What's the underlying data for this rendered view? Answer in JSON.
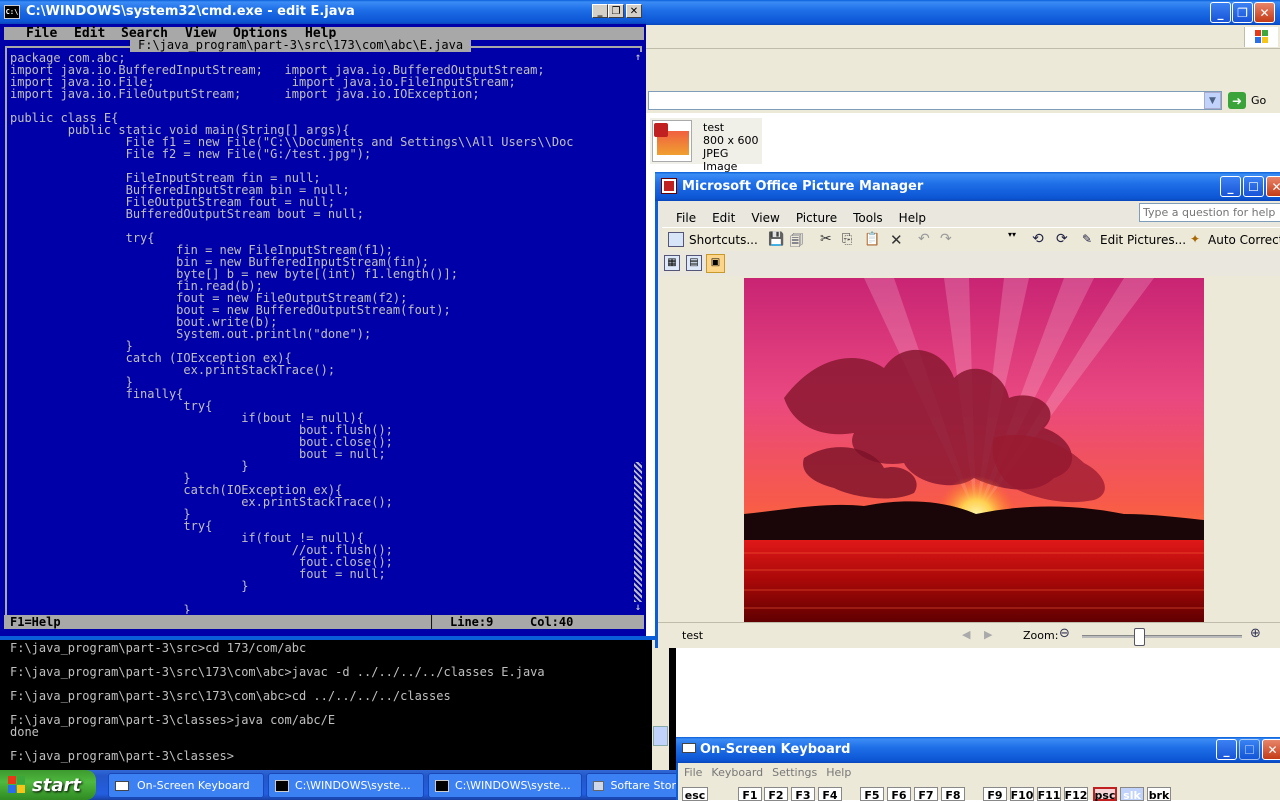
{
  "background_window": {
    "go_label": "Go",
    "file_name": "test",
    "file_dims": "800 x 600",
    "file_type": "JPEG Image"
  },
  "cmd": {
    "title": "C:\\WINDOWS\\system32\\cmd.exe - edit E.java",
    "menu": [
      "File",
      "Edit",
      "Search",
      "View",
      "Options",
      "Help"
    ],
    "file_path": "F:\\java_program\\part-3\\src\\173\\com\\abc\\E.java",
    "code": "package com.abc;\nimport java.io.BufferedInputStream;   import java.io.BufferedOutputStream;\nimport java.io.File;                   import java.io.FileInputStream;\nimport java.io.FileOutputStream;      import java.io.IOException;\n\npublic class E{\n        public static void main(String[] args){\n                File f1 = new File(\"C:\\\\Documents and Settings\\\\All Users\\\\Doc\n                File f2 = new File(\"G:/test.jpg\");\n\n                FileInputStream fin = null;\n                BufferedInputStream bin = null;\n                FileOutputStream fout = null;\n                BufferedOutputStream bout = null;\n\n                try{\n                       fin = new FileInputStream(f1);\n                       bin = new BufferedInputStream(fin);\n                       byte[] b = new byte[(int) f1.length()];\n                       fin.read(b);\n                       fout = new FileOutputStream(f2);\n                       bout = new BufferedOutputStream(fout);\n                       bout.write(b);\n                       System.out.println(\"done\");\n                }\n                catch (IOException ex){\n                        ex.printStackTrace();\n                }\n                finally{\n                        try{\n                                if(bout != null){\n                                        bout.flush();\n                                        bout.close();\n                                        bout = null;\n                                }\n                        }\n                        catch(IOException ex){\n                                ex.printStackTrace();\n                        }\n                        try{\n                                if(fout != null){\n                                       //out.flush();\n                                        fout.close();\n                                        fout = null;\n                                }\n\n                        }",
    "status_help": "F1=Help",
    "status_line": "Line:9",
    "status_col": "Col:40",
    "console": "F:\\java_program\\part-3\\src>cd 173/com/abc\n\nF:\\java_program\\part-3\\src\\173\\com\\abc>javac -d ../../../../classes E.java\n\nF:\\java_program\\part-3\\src\\173\\com\\abc>cd ../../../../classes\n\nF:\\java_program\\part-3\\classes>java com/abc/E\ndone\n\nF:\\java_program\\part-3\\classes>"
  },
  "picture_manager": {
    "title": "Microsoft Office Picture Manager",
    "menu": [
      "File",
      "Edit",
      "View",
      "Picture",
      "Tools",
      "Help"
    ],
    "help_placeholder": "Type a question for help",
    "shortcuts_label": "Shortcuts...",
    "edit_pictures_label": "Edit Pictures...",
    "auto_correct_label": "Auto Correct",
    "status_name": "test",
    "zoom_label": "Zoom:",
    "zoom_fraction": 0.36
  },
  "osk": {
    "title": "On-Screen Keyboard",
    "menu": [
      "File",
      "Keyboard",
      "Settings",
      "Help"
    ],
    "keys": [
      "esc",
      "F1",
      "F2",
      "F3",
      "F4",
      "F5",
      "F6",
      "F7",
      "F8",
      "F9",
      "F10",
      "F11",
      "F12",
      "psc",
      "slk",
      "brk"
    ]
  },
  "taskbar": {
    "start_label": "start",
    "tasks": [
      "On-Screen Keyboard",
      "C:\\WINDOWS\\syste...",
      "C:\\WINDOWS\\syste...",
      "Softare Stor"
    ]
  },
  "colors": {
    "cmd_blue": "#0000a8",
    "xp_title_blue": "#0a5fd8",
    "start_green": "#3c9a2e"
  }
}
